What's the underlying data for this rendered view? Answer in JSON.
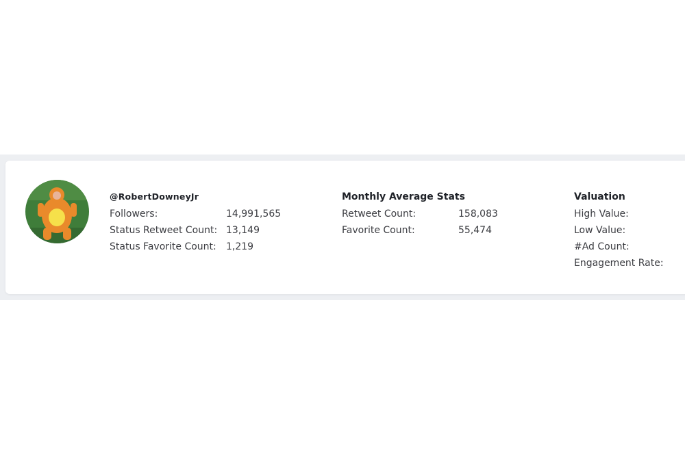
{
  "profile": {
    "handle": "@RobertDowneyJr",
    "stats": [
      {
        "label": "Followers:",
        "value": "14,991,565"
      },
      {
        "label": "Status Retweet Count:",
        "value": "13,149"
      },
      {
        "label": "Status Favorite Count:",
        "value": "1,219"
      }
    ]
  },
  "monthly": {
    "title": "Monthly Average Stats",
    "stats": [
      {
        "label": "Retweet Count:",
        "value": "158,083"
      },
      {
        "label": "Favorite Count:",
        "value": "55,474"
      }
    ]
  },
  "valuation": {
    "title": "Valuation",
    "stats": [
      {
        "label": "High Value:",
        "value": ""
      },
      {
        "label": "Low Value:",
        "value": ""
      },
      {
        "label": "#Ad Count:",
        "value": ""
      },
      {
        "label": "Engagement Rate:",
        "value": ""
      }
    ]
  },
  "colors": {
    "band": "#edeff2",
    "card": "#ffffff",
    "text": "#2b2b31",
    "avatar_grass": "#3f7d3a",
    "avatar_costume": "#e98a2b"
  },
  "icons": {
    "avatar": "profile-photo-icon"
  }
}
